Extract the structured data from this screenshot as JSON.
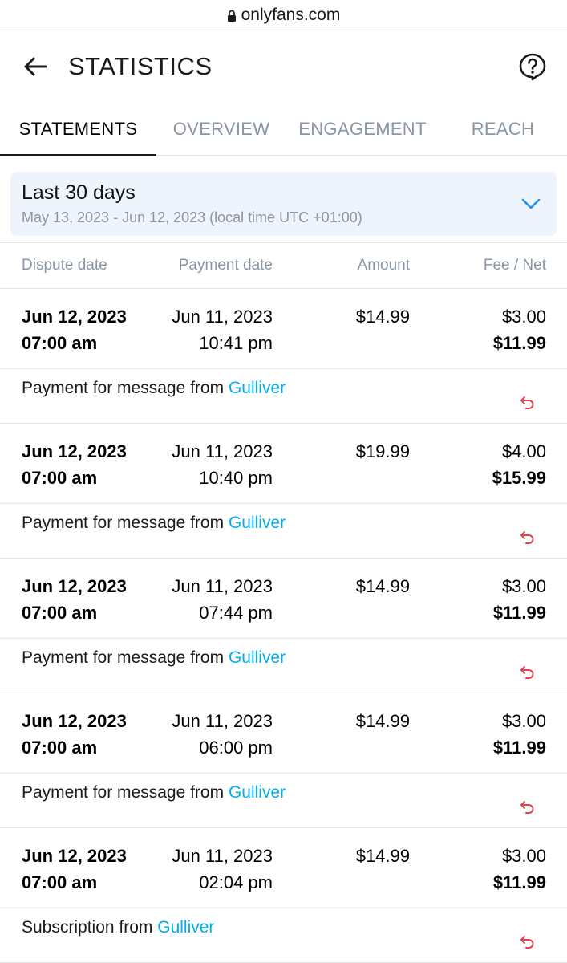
{
  "browser": {
    "url": "onlyfans.com"
  },
  "header": {
    "title": "STATISTICS"
  },
  "tabs": [
    {
      "label": "STATEMENTS",
      "active": true
    },
    {
      "label": "OVERVIEW",
      "active": false
    },
    {
      "label": "ENGAGEMENT",
      "active": false
    },
    {
      "label": "REACH",
      "active": false
    }
  ],
  "range": {
    "label": "Last 30 days",
    "sub": "May 13, 2023 - Jun 12, 2023 (local time UTC +01:00)"
  },
  "columns": {
    "dispute_date": "Dispute date",
    "payment_date": "Payment date",
    "amount": "Amount",
    "fee_net": "Fee / Net"
  },
  "entries": [
    {
      "dispute_date": "Jun 12, 2023",
      "dispute_time": "07:00 am",
      "payment_date": "Jun 11, 2023",
      "payment_time": "10:41 pm",
      "amount": "$14.99",
      "fee": "$3.00",
      "net": "$11.99",
      "description": "Payment for message from ",
      "user": "Gulliver"
    },
    {
      "dispute_date": "Jun 12, 2023",
      "dispute_time": "07:00 am",
      "payment_date": "Jun 11, 2023",
      "payment_time": "10:40 pm",
      "amount": "$19.99",
      "fee": "$4.00",
      "net": "$15.99",
      "description": "Payment for message from ",
      "user": "Gulliver"
    },
    {
      "dispute_date": "Jun 12, 2023",
      "dispute_time": "07:00 am",
      "payment_date": "Jun 11, 2023",
      "payment_time": "07:44 pm",
      "amount": "$14.99",
      "fee": "$3.00",
      "net": "$11.99",
      "description": "Payment for message from ",
      "user": "Gulliver"
    },
    {
      "dispute_date": "Jun 12, 2023",
      "dispute_time": "07:00 am",
      "payment_date": "Jun 11, 2023",
      "payment_time": "06:00 pm",
      "amount": "$14.99",
      "fee": "$3.00",
      "net": "$11.99",
      "description": "Payment for message from ",
      "user": "Gulliver"
    },
    {
      "dispute_date": "Jun 12, 2023",
      "dispute_time": "07:00 am",
      "payment_date": "Jun 11, 2023",
      "payment_time": "02:04 pm",
      "amount": "$14.99",
      "fee": "$3.00",
      "net": "$11.99",
      "description": "Subscription from ",
      "user": "Gulliver"
    }
  ],
  "colors": {
    "accent": "#00aff0",
    "muted": "#8a96a3",
    "refund": "#e0424b",
    "range_bg": "#eef4fb"
  },
  "icons": {
    "lock": "lock-icon",
    "back": "back-arrow-icon",
    "help": "help-bubble-icon",
    "chevron": "chevron-down-icon",
    "refund": "refund-icon"
  }
}
